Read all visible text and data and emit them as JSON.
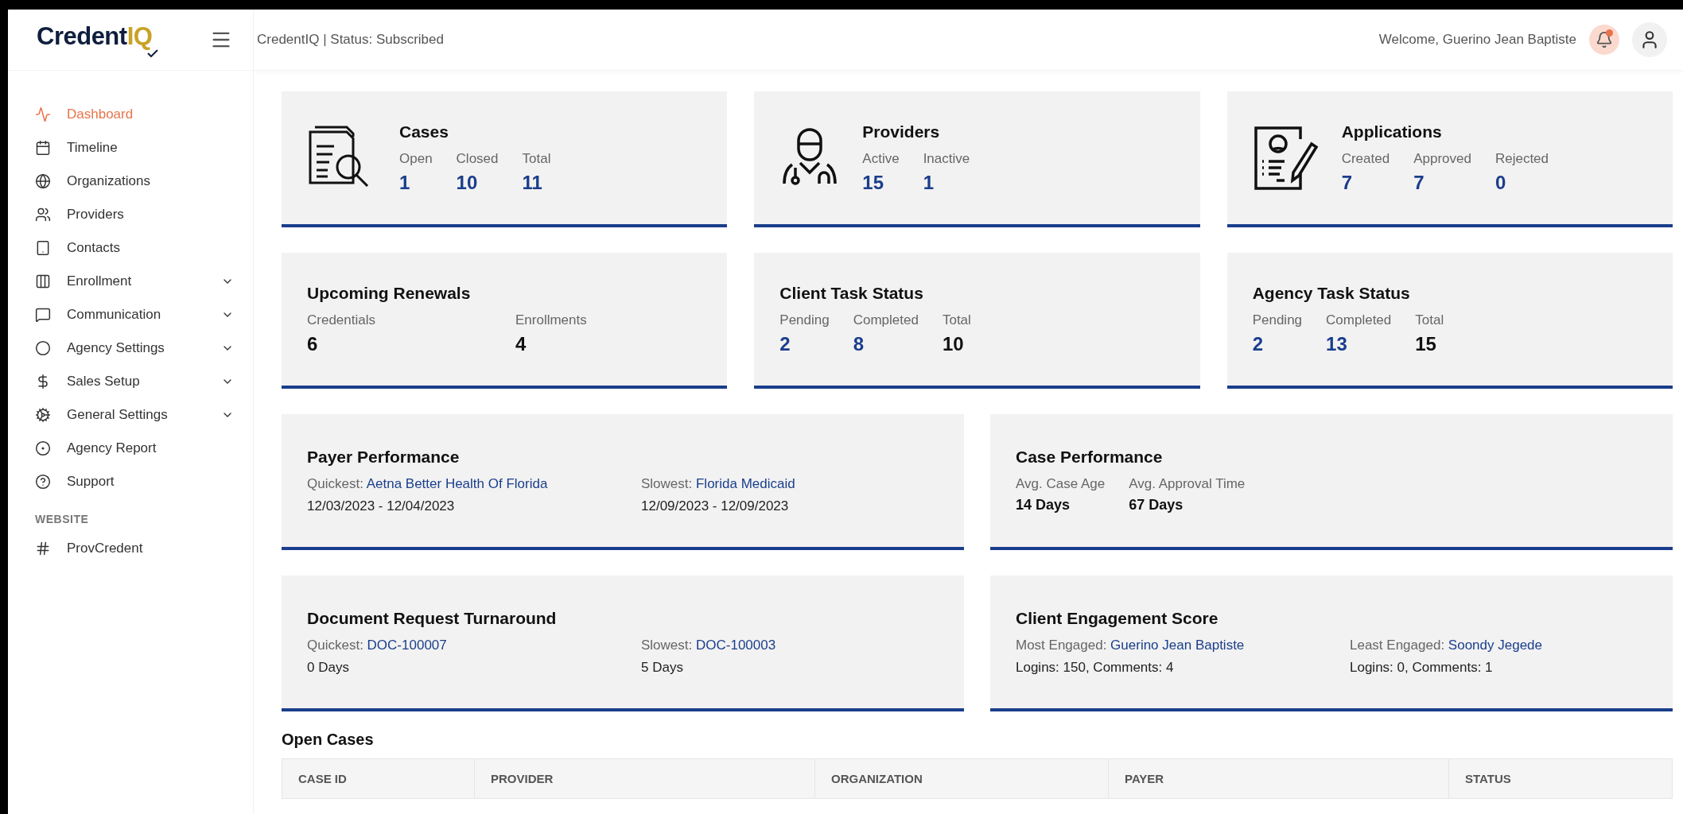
{
  "logo": {
    "main": "Credent",
    "accent": "IQ"
  },
  "header": {
    "status": "CredentIQ | Status: Subscribed",
    "welcome": "Welcome, Guerino Jean Baptiste",
    "has_notification": true
  },
  "sidebar": {
    "items": [
      {
        "label": "Dashboard",
        "selected": true,
        "has_submenu": false
      },
      {
        "label": "Timeline",
        "selected": false,
        "has_submenu": false
      },
      {
        "label": "Organizations",
        "selected": false,
        "has_submenu": false
      },
      {
        "label": "Providers",
        "selected": false,
        "has_submenu": false
      },
      {
        "label": "Contacts",
        "selected": false,
        "has_submenu": false
      },
      {
        "label": "Enrollment",
        "selected": false,
        "has_submenu": true
      },
      {
        "label": "Communication",
        "selected": false,
        "has_submenu": true
      },
      {
        "label": "Agency Settings",
        "selected": false,
        "has_submenu": true
      },
      {
        "label": "Sales Setup",
        "selected": false,
        "has_submenu": true
      },
      {
        "label": "General Settings",
        "selected": false,
        "has_submenu": true
      },
      {
        "label": "Agency Report",
        "selected": false,
        "has_submenu": false
      },
      {
        "label": "Support",
        "selected": false,
        "has_submenu": false
      }
    ],
    "section": "WEBSITE",
    "section_items": [
      {
        "label": "ProvCredent",
        "selected": false
      }
    ]
  },
  "card_rows": [
    [
      {
        "kind": "icon_stats",
        "title": "Cases",
        "stats": [
          {
            "label": "Open",
            "value": "1",
            "color": "#1a3e8c"
          },
          {
            "label": "Closed",
            "value": "10",
            "color": "#1a3e8c"
          },
          {
            "label": "Total",
            "value": "11",
            "color": "#1a3e8c"
          }
        ]
      },
      {
        "kind": "icon_stats",
        "title": "Providers",
        "stats": [
          {
            "label": "Active",
            "value": "15",
            "color": "#1a3e8c"
          },
          {
            "label": "Inactive",
            "value": "1",
            "color": "#1a3e8c"
          }
        ]
      },
      {
        "kind": "icon_stats",
        "title": "Applications",
        "stats": [
          {
            "label": "Created",
            "value": "7",
            "color": "#1a3e8c"
          },
          {
            "label": "Approved",
            "value": "7",
            "color": "#1a3e8c"
          },
          {
            "label": "Rejected",
            "value": "0",
            "color": "#1a3e8c"
          }
        ]
      }
    ],
    [
      {
        "kind": "wide_stats",
        "title": "Upcoming Renewals",
        "stats": [
          {
            "label": "Credentials",
            "value": "6",
            "color": "#111111"
          },
          {
            "label": "Enrollments",
            "value": "4",
            "color": "#111111"
          }
        ]
      },
      {
        "kind": "stats",
        "title": "Client Task Status",
        "stats": [
          {
            "label": "Pending",
            "value": "2",
            "color": "#1a3e8c"
          },
          {
            "label": "Completed",
            "value": "8",
            "color": "#1a3e8c"
          },
          {
            "label": "Total",
            "value": "10",
            "color": "#111111"
          }
        ]
      },
      {
        "kind": "stats",
        "title": "Agency Task Status",
        "stats": [
          {
            "label": "Pending",
            "value": "2",
            "color": "#1a3e8c"
          },
          {
            "label": "Completed",
            "value": "13",
            "color": "#1a3e8c"
          },
          {
            "label": "Total",
            "value": "15",
            "color": "#111111"
          }
        ]
      }
    ],
    [
      {
        "kind": "leaders",
        "title": "Payer Performance",
        "leaders": [
          {
            "label": "Quickest:",
            "link": "Aetna Better Health Of Florida",
            "detail": "12/03/2023 - 12/04/2023"
          },
          {
            "label": "Slowest:",
            "link": "Florida Medicaid",
            "detail": "12/09/2023 - 12/09/2023"
          }
        ]
      },
      {
        "kind": "small_stats",
        "title": "Case Performance",
        "stats": [
          {
            "label": "Avg. Case Age",
            "value": "14 Days",
            "color": "#111111"
          },
          {
            "label": "Avg. Approval Time",
            "value": "67 Days",
            "color": "#111111"
          }
        ]
      }
    ],
    [
      {
        "kind": "leaders",
        "title": "Document Request Turnaround",
        "leaders": [
          {
            "label": "Quickest:",
            "link": "DOC-100007",
            "detail": "0 Days"
          },
          {
            "label": "Slowest:",
            "link": "DOC-100003",
            "detail": "5 Days"
          }
        ]
      },
      {
        "kind": "leaders",
        "title": "Client Engagement Score",
        "leaders": [
          {
            "label": "Most Engaged:",
            "link": "Guerino Jean Baptiste",
            "detail": "Logins: 150, Comments: 4"
          },
          {
            "label": "Least Engaged:",
            "link": "Soondy Jegede",
            "detail": "Logins: 0, Comments: 1"
          }
        ]
      }
    ]
  ],
  "open_cases": {
    "title": "Open Cases",
    "columns": [
      "CASE ID",
      "PROVIDER",
      "ORGANIZATION",
      "PAYER",
      "STATUS"
    ]
  }
}
